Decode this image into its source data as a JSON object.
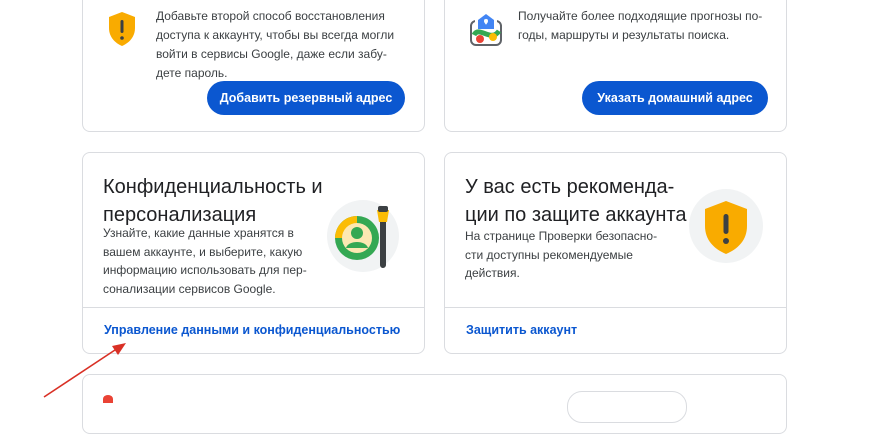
{
  "cards": {
    "recovery": {
      "description": [
        "Добавьте второй способ восстановления",
        "доступа к аккаунту, чтобы вы всегда могли",
        "войти в сервисы Google, даже если забу-",
        "дете пароль."
      ],
      "button_label": "Добавить резервный адрес",
      "icon": "warning-shield-icon",
      "icon_color": "#f9ab00"
    },
    "home_address": {
      "description": [
        "Получайте более подходящие прогнозы по-",
        "годы, маршруты и результаты поиска."
      ],
      "button_label": "Указать домашний адрес",
      "icon": "home-map-icon"
    },
    "privacy": {
      "title": [
        "Конфиденциальность и",
        "персонализация"
      ],
      "description": [
        "Узнайте, какие данные хранятся в",
        "вашем аккаунте, и выберите, какую",
        "информацию использовать для пер-",
        "сонализации сервисов Google."
      ],
      "link_label": "Управление данными и конфиденциальностью",
      "icon": "privacy-personalization-icon"
    },
    "security": {
      "title": [
        "У вас есть рекоменда-",
        "ции по защите аккаунта"
      ],
      "description": [
        "На странице Проверки безопасно-",
        "сти доступны рекомендуемые",
        "действия."
      ],
      "link_label": "Защитить аккаунт",
      "icon": "warning-shield-icon",
      "icon_color": "#f9ab00"
    }
  },
  "colors": {
    "accent_blue": "#0b57d0",
    "border": "#dadce0",
    "warning_yellow": "#f9ab00",
    "annotation_arrow": "#d93025"
  }
}
